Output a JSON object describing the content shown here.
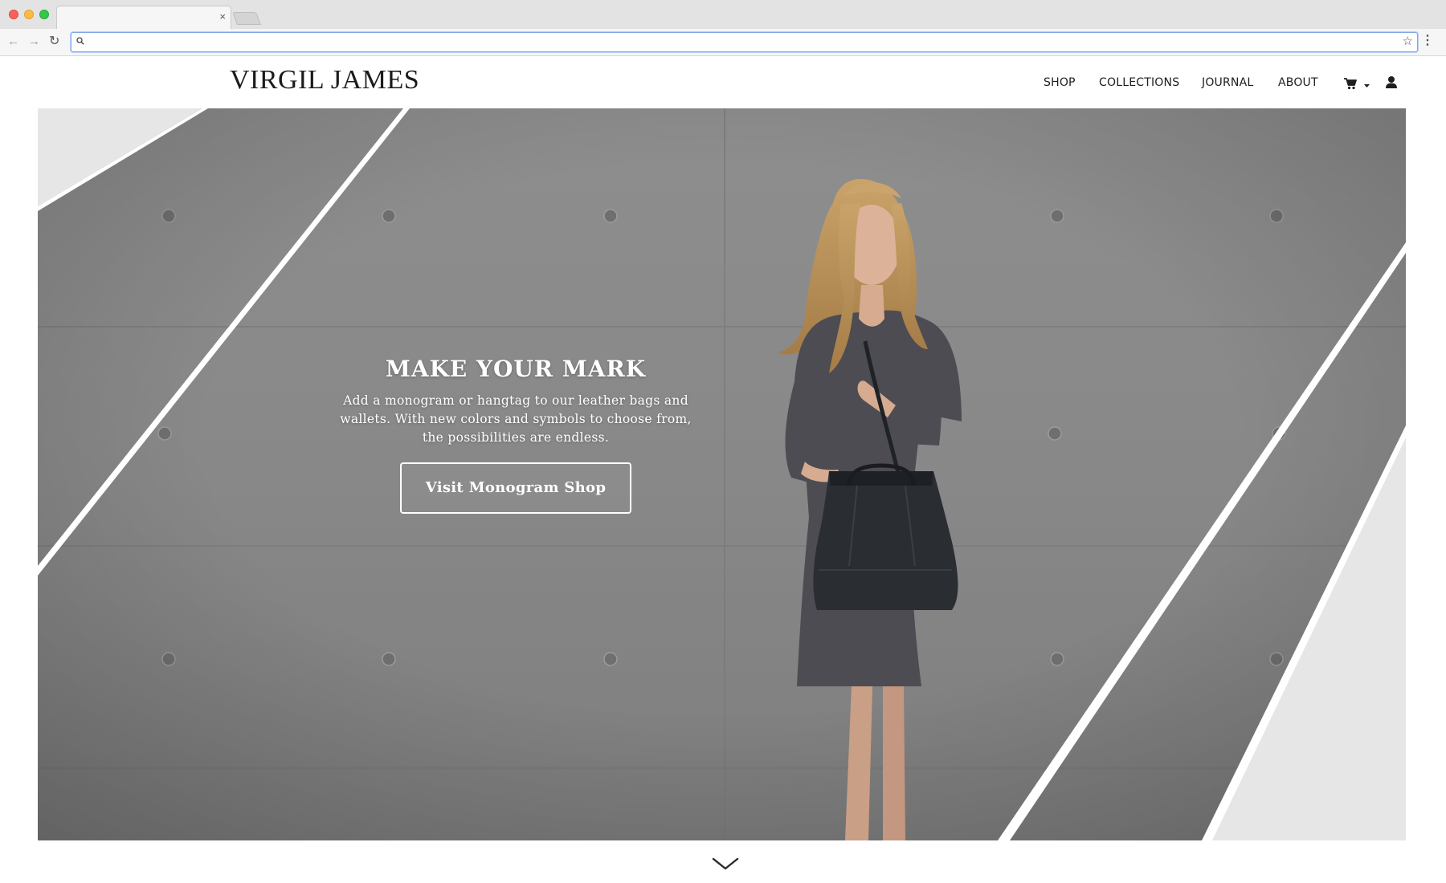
{
  "browser": {
    "tab_close": "×",
    "url_value": "",
    "nav_back": "←",
    "nav_forward": "→",
    "reload": "↻",
    "bookmark": "☆",
    "menu": "⋮"
  },
  "site": {
    "logo": "VIRGIL JAMES",
    "nav": {
      "shop": "SHOP",
      "collections": "COLLECTIONS",
      "journal": "JOURNAL",
      "about": "ABOUT"
    },
    "icons": [
      "cart-icon",
      "dropdown-caret-icon",
      "user-icon",
      "chevron-down-icon"
    ]
  },
  "hero": {
    "title": "MAKE YOUR MARK",
    "text": "Add a monogram or hangtag to our leather bags and wallets. With new colors and symbols to choose from, the possibilities are endless.",
    "button": "Visit Monogram Shop"
  },
  "colors": {
    "concrete": "#8b8b8b",
    "stripe": "#ffffff",
    "panel": "#e6e6e6",
    "text_dark": "#1e1e1e"
  }
}
